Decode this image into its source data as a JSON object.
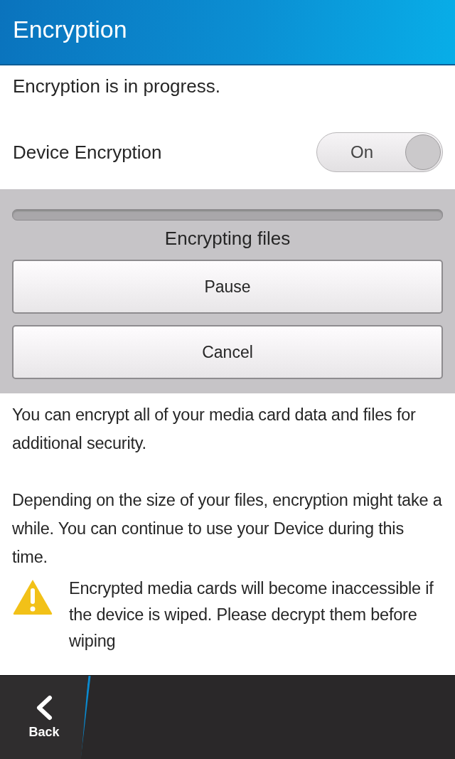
{
  "title_bar": {
    "title": "Encryption"
  },
  "status": "Encryption is in progress.",
  "setting": {
    "label": "Device Encryption",
    "toggle": {
      "label": "On",
      "on": true
    }
  },
  "progress_panel": {
    "level": 0,
    "caption": "Encrypting files",
    "buttons": [
      "Pause",
      "Cancel"
    ]
  },
  "paragraphs": [
    "You can encrypt all of your media card data and files for additional security.",
    "Depending on the size of your files, encryption might take a while. You can continue to use your Device during this time."
  ],
  "warning": "Encrypted media cards will become inaccessible if the device is wiped. Please decrypt them before wiping",
  "action_bar": {
    "back_label": "Back"
  }
}
